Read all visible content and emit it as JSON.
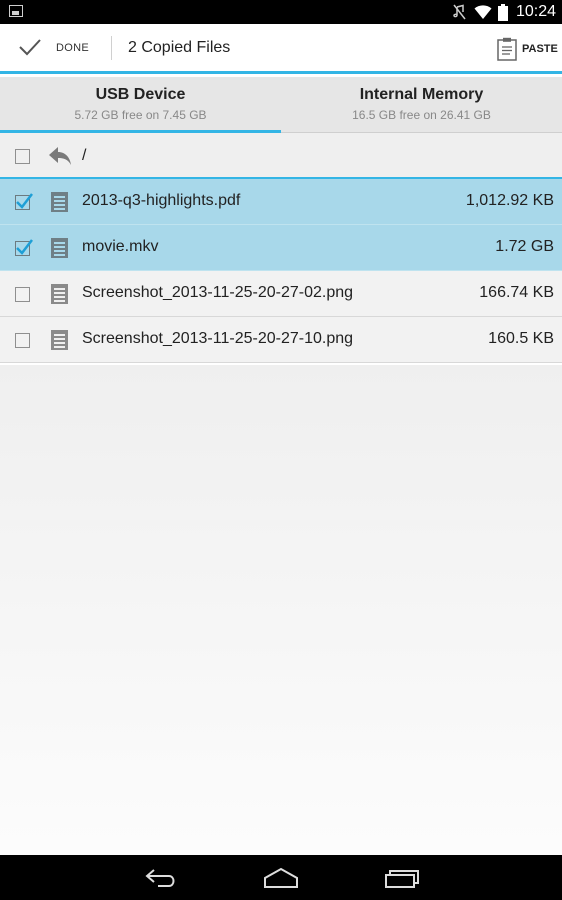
{
  "status_bar": {
    "time": "10:24",
    "icons": [
      "picture-notification-icon",
      "mute-icon",
      "wifi-icon",
      "battery-icon"
    ]
  },
  "action_bar": {
    "done_label": "DONE",
    "title": "2 Copied Files",
    "paste_label": "PASTE"
  },
  "tabs": [
    {
      "name": "USB Device",
      "free": "5.72 GB free on 7.45 GB",
      "active": true
    },
    {
      "name": "Internal Memory",
      "free": "16.5 GB free on 26.41 GB",
      "active": false
    }
  ],
  "path": "/",
  "files": [
    {
      "name": "2013-q3-highlights.pdf",
      "size": "1,012.92 KB",
      "checked": true
    },
    {
      "name": "movie.mkv",
      "size": "1.72 GB",
      "checked": true
    },
    {
      "name": "Screenshot_2013-11-25-20-27-02.png",
      "size": "166.74 KB",
      "checked": false
    },
    {
      "name": "Screenshot_2013-11-25-20-27-10.png",
      "size": "160.5 KB",
      "checked": false
    }
  ],
  "colors": {
    "accent": "#33b5e5",
    "selected_row": "#a8d8ea",
    "checkmark": "#1e9fd6"
  }
}
